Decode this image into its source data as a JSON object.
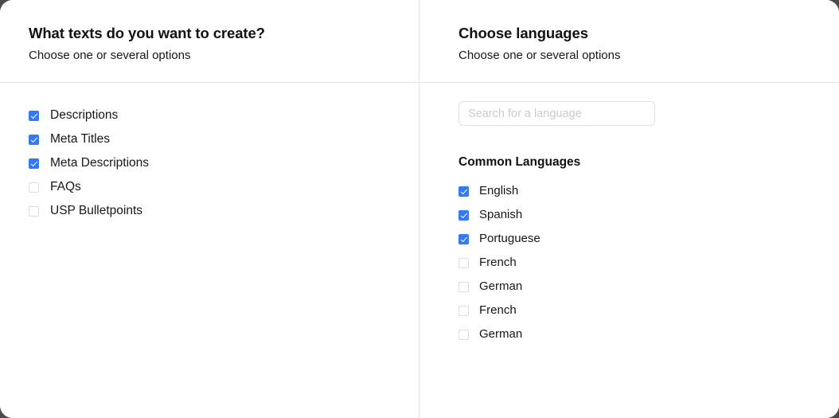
{
  "theme": {
    "card_background": "#ffffff",
    "page_background": "#4b4b4f",
    "accent": "#3579f6",
    "divider": "#e4e4e6",
    "text_primary": "#17171a",
    "placeholder": "#cbcbd0",
    "checkbox_border": "#dcdce0"
  },
  "left_panel": {
    "title": "What texts do you want to create?",
    "subtitle": "Choose one or several options",
    "options": [
      {
        "label": "Descriptions",
        "checked": true
      },
      {
        "label": "Meta Titles",
        "checked": true
      },
      {
        "label": "Meta Descriptions",
        "checked": true
      },
      {
        "label": "FAQs",
        "checked": false
      },
      {
        "label": "USP Bulletpoints",
        "checked": false
      }
    ]
  },
  "right_panel": {
    "title": "Choose languages",
    "subtitle": "Choose one or several options",
    "search": {
      "value": "",
      "placeholder": "Search for a language"
    },
    "group_heading": "Common Languages",
    "languages": [
      {
        "label": "English",
        "checked": true
      },
      {
        "label": "Spanish",
        "checked": true
      },
      {
        "label": "Portuguese",
        "checked": true
      },
      {
        "label": "French",
        "checked": false
      },
      {
        "label": "German",
        "checked": false
      },
      {
        "label": "French",
        "checked": false
      },
      {
        "label": "German",
        "checked": false
      }
    ]
  }
}
